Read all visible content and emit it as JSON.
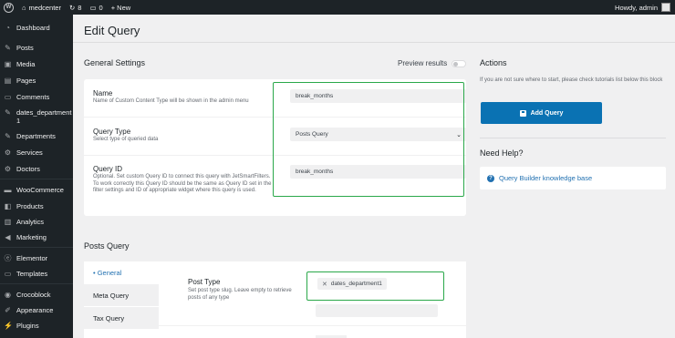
{
  "admin_bar": {
    "site_name": "medcenter",
    "updates_count": "8",
    "comments_count": "0",
    "new_label": "+ New",
    "greeting": "Howdy, admin"
  },
  "sidebar": {
    "items": [
      {
        "label": "Dashboard",
        "icon": "dashboard-icon"
      },
      {
        "label": "Posts",
        "icon": "pin-icon"
      },
      {
        "label": "Media",
        "icon": "media-icon"
      },
      {
        "label": "Pages",
        "icon": "pages-icon"
      },
      {
        "label": "Comments",
        "icon": "comments-icon"
      },
      {
        "label": "dates_department 1",
        "icon": "pin-icon"
      },
      {
        "label": "Departments",
        "icon": "pin-icon"
      },
      {
        "label": "Services",
        "icon": "gear-icon"
      },
      {
        "label": "Doctors",
        "icon": "gear-icon"
      },
      {
        "label": "WooCommerce",
        "icon": "woo-icon"
      },
      {
        "label": "Products",
        "icon": "box-icon"
      },
      {
        "label": "Analytics",
        "icon": "chart-icon"
      },
      {
        "label": "Marketing",
        "icon": "megaphone-icon"
      },
      {
        "label": "Elementor",
        "icon": "elementor-icon"
      },
      {
        "label": "Templates",
        "icon": "folder-icon"
      },
      {
        "label": "Crocoblock",
        "icon": "croco-icon"
      },
      {
        "label": "Appearance",
        "icon": "brush-icon"
      },
      {
        "label": "Plugins",
        "icon": "plug-icon"
      }
    ]
  },
  "page": {
    "title": "Edit Query"
  },
  "general_settings": {
    "title": "General Settings",
    "preview_label": "Preview results",
    "name": {
      "label": "Name",
      "description": "Name of Custom Content Type will be shown in the admin menu",
      "value": "break_months"
    },
    "query_type": {
      "label": "Query Type",
      "description": "Select type of queried data",
      "value": "Posts Query"
    },
    "query_id": {
      "label": "Query ID",
      "description": "Optional. Set custom Query ID to connect this query with JetSmartFilters. To work correctly this Query ID should be the same as Query ID set in the filter settings and ID of appropriate widget where this query is used.",
      "value": "break_months"
    }
  },
  "actions": {
    "title": "Actions",
    "description": "If you are not sure where to start, please check tutorials list below this block",
    "add_button": "Add Query"
  },
  "help": {
    "title": "Need Help?",
    "link": "Query Builder knowledge base"
  },
  "posts_query": {
    "title": "Posts Query",
    "tabs": [
      "• General",
      "Meta Query",
      "Tax Query"
    ],
    "post_type": {
      "label": "Post Type",
      "description": "Set post type slug. Leave empty to retrieve posts of any type",
      "chip": "dates_department1"
    }
  },
  "colors": {
    "admin_dark": "#1d2327",
    "primary_button": "#0a72b3",
    "link": "#2271b1",
    "highlight_green": "#2aa84a"
  }
}
